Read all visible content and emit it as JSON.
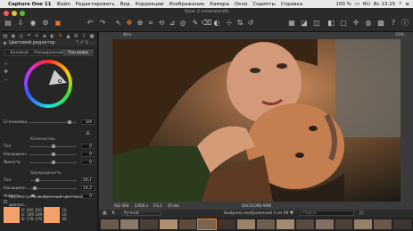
{
  "menubar": {
    "items": [
      "Capture One 11",
      "Файл",
      "Редактировать",
      "Вид",
      "Коррекции",
      "Изображение",
      "Камера",
      "Окно",
      "Скрипты",
      "Справка"
    ],
    "battery": "100 %",
    "lang": "RU",
    "time": "Вс 13:15"
  },
  "window": {
    "title": "Урок 2.cosessiondb"
  },
  "panel": {
    "title": "Цветовой редактор",
    "tabs": [
      "Базовый",
      "Расширенный",
      "Тон кожи"
    ],
    "active_tab": "Тон кожи",
    "rows": {
      "smoothness": {
        "label": "Сглаживан...",
        "value": "3/4"
      },
      "amount_title": "Количество",
      "amount_hue": {
        "label": "Тон",
        "value": "0"
      },
      "amount_sat": {
        "label": "Насыщенн...",
        "value": "0"
      },
      "amount_bright": {
        "label": "Яркость",
        "value": "0"
      },
      "uni_title": "Однородность",
      "uni_hue": {
        "label": "Тон",
        "value": "20,1"
      },
      "uni_sat": {
        "label": "Насыщенн...",
        "value": "14,2"
      },
      "uni_bright": {
        "label": "Яркость",
        "value": "0"
      }
    },
    "checkbox_label": "Просмотреть выбранный цветовой диапаз...",
    "swatch_a": {
      "color": "#f4a06a",
      "rgb": "R: 200 200\nG: 189 189\nB: 178 178"
    },
    "swatch_b": {
      "color": "#f4a06a",
      "rgb": "16\n16\n40"
    }
  },
  "viewer": {
    "label": "Фон",
    "zoom": "33%",
    "meta": [
      "ISO 400",
      "1/400 s",
      "f/3,2",
      "35 мм"
    ],
    "filename": "DSC01086.ARW"
  },
  "filmbar": {
    "sort_value": "Ручной",
    "count_text": "Выбрано изображений 1 из 68",
    "search_placeholder": "Поиск"
  },
  "colors": {
    "accent": "#f07c2c",
    "close": "#fc5b57",
    "minimize": "#e5bf3c",
    "zoom": "#57c038"
  },
  "filmstrip": {
    "thumb_colors": [
      "#6b5b4a",
      "#8a7a68",
      "#4a3f36",
      "#b09070",
      "#5d4c3c",
      "#7a6650",
      "#3e342d",
      "#9a826a",
      "#6e5e4e",
      "#a38a70",
      "#584a3e",
      "#827060",
      "#4c4038",
      "#95806a",
      "#6a5848",
      "#3c3430"
    ]
  }
}
